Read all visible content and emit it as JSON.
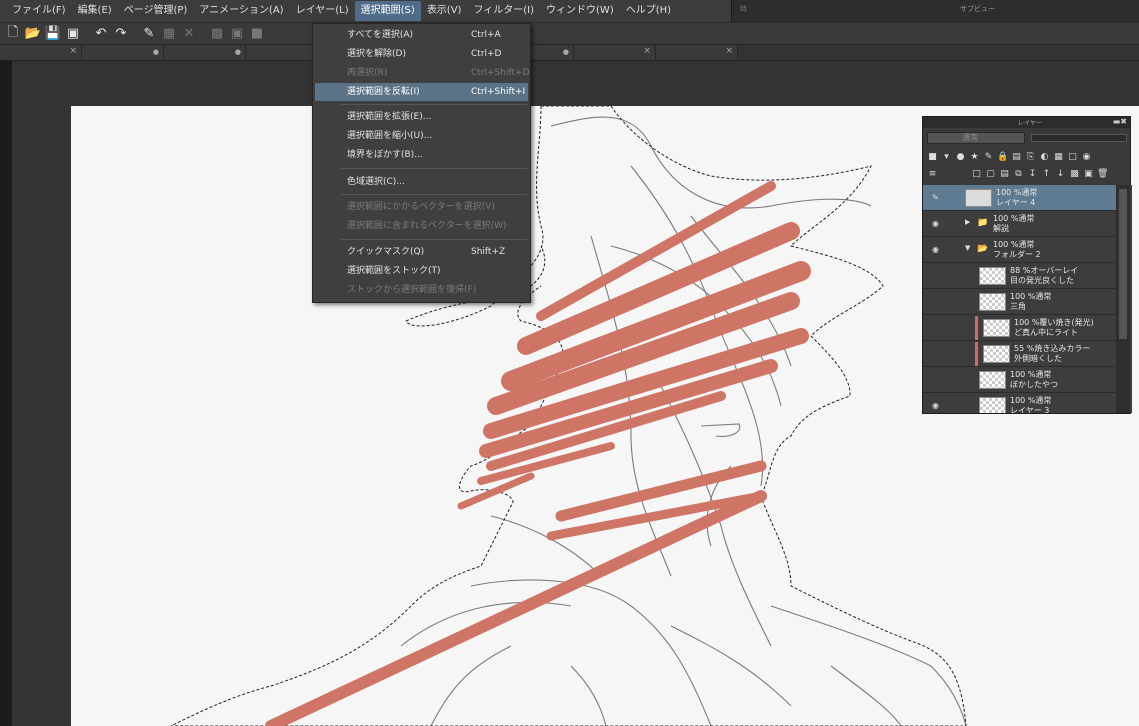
{
  "menubar": {
    "items": [
      {
        "label": "ファイル(F)"
      },
      {
        "label": "編集(E)"
      },
      {
        "label": "ページ管理(P)"
      },
      {
        "label": "アニメーション(A)"
      },
      {
        "label": "レイヤー(L)"
      },
      {
        "label": "選択範囲(S)",
        "active": true
      },
      {
        "label": "表示(V)"
      },
      {
        "label": "フィルター(I)"
      },
      {
        "label": "ウィンドウ(W)"
      },
      {
        "label": "ヘルプ(H)"
      }
    ]
  },
  "subview": {
    "title": "サブビュー",
    "side_label": "特"
  },
  "selection_menu": {
    "items": [
      {
        "label": "すべてを選択(A)",
        "shortcut": "Ctrl+A",
        "disabled": false
      },
      {
        "label": "選択を解除(D)",
        "shortcut": "Ctrl+D",
        "disabled": false
      },
      {
        "label": "再選択(R)",
        "shortcut": "Ctrl+Shift+D",
        "disabled": true
      },
      {
        "label": "選択範囲を反転(I)",
        "shortcut": "Ctrl+Shift+I",
        "disabled": false,
        "highlighted": true
      },
      {
        "label": "選択範囲を拡張(E)...",
        "shortcut": "",
        "disabled": false
      },
      {
        "label": "選択範囲を縮小(U)...",
        "shortcut": "",
        "disabled": false
      },
      {
        "label": "境界をぼかす(B)...",
        "shortcut": "",
        "disabled": false
      },
      {
        "label": "色域選択(C)...",
        "shortcut": "",
        "disabled": false
      },
      {
        "label": "選択範囲にかかるベクターを選択(V)",
        "shortcut": "",
        "disabled": true
      },
      {
        "label": "選択範囲に含まれるベクターを選択(W)",
        "shortcut": "",
        "disabled": true
      },
      {
        "label": "クイックマスク(Q)",
        "shortcut": "Shift+Z",
        "disabled": false
      },
      {
        "label": "選択範囲をストック(T)",
        "shortcut": "",
        "disabled": false
      },
      {
        "label": "ストックから選択範囲を復帰(F)",
        "shortcut": "",
        "disabled": true
      }
    ]
  },
  "layer_panel": {
    "title": "レイヤー",
    "blend_mode": "通常",
    "layers": [
      {
        "line1": "100 %通常",
        "line2": "レイヤー 4",
        "type": "layer",
        "selected": true,
        "visible": true
      },
      {
        "line1": "100 %通常",
        "line2": "解説",
        "type": "folder-closed",
        "visible": true
      },
      {
        "line1": "100 %通常",
        "line2": "フォルダー 2",
        "type": "folder-open",
        "visible": true
      },
      {
        "line1": "88 %オーバーレイ",
        "line2": "目の発光良くした",
        "type": "child",
        "visible": false
      },
      {
        "line1": "100 %通常",
        "line2": "三角",
        "type": "child",
        "visible": false
      },
      {
        "line1": "100 %覆い焼き(発光)",
        "line2": "ど真ん中にライト",
        "type": "child-clip",
        "visible": false
      },
      {
        "line1": "55 %焼き込みカラー",
        "line2": "外側暗くした",
        "type": "child-clip",
        "visible": false
      },
      {
        "line1": "100 %通常",
        "line2": "ぼかしたやつ",
        "type": "child",
        "visible": false
      },
      {
        "line1": "100 %通常",
        "line2": "レイヤー 3",
        "type": "layer",
        "visible": true
      }
    ]
  },
  "colors": {
    "menu_highlight": "#5a7387",
    "brush_stroke": "#cf7566",
    "layer_selected": "#5f7b91"
  }
}
